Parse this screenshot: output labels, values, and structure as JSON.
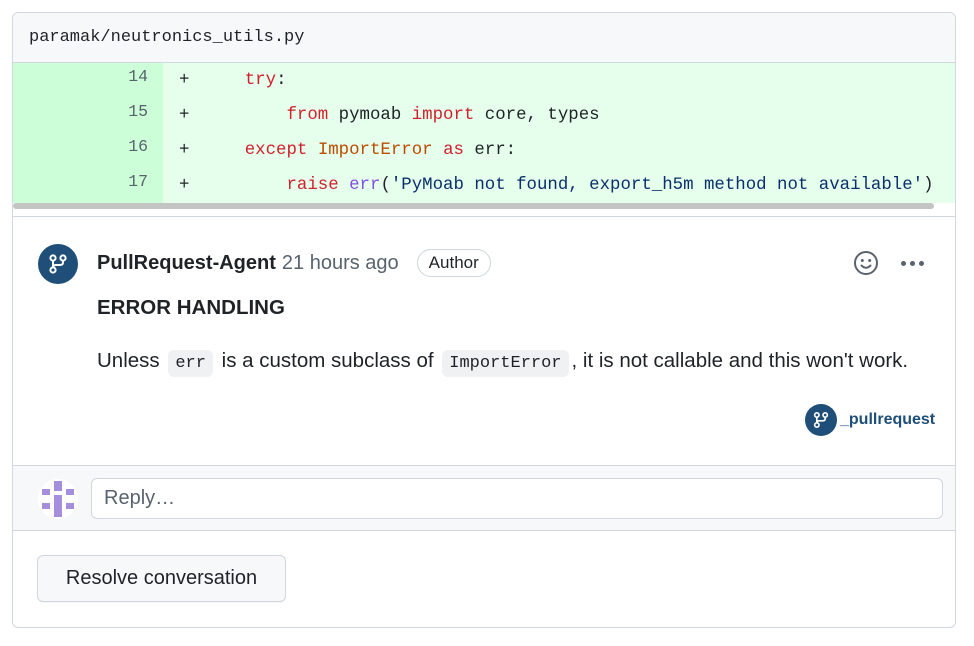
{
  "file": {
    "path": "paramak/neutronics_utils.py"
  },
  "diff": {
    "lines": [
      {
        "number": "14",
        "sign": "+"
      },
      {
        "number": "15",
        "sign": "+"
      },
      {
        "number": "16",
        "sign": "+"
      },
      {
        "number": "17",
        "sign": "+"
      }
    ],
    "tokens": {
      "try": "try",
      "colon": ":",
      "from": "from",
      "pymoab": " pymoab ",
      "import": "import",
      "core_types": " core, types",
      "except": "except",
      "importerror": "ImportError",
      "as": "as",
      "err_colon": " err:",
      "raise": "raise",
      "err_fn": "err",
      "paren_open": "(",
      "message": "'PyMoab not found, export_h5m method not available'",
      "paren_close": ")"
    }
  },
  "comment": {
    "author": "PullRequest-Agent",
    "time": "21 hours ago",
    "badge": "Author",
    "heading": "ERROR HANDLING",
    "body": {
      "part1": "Unless ",
      "code1": "err",
      "part2": " is a custom subclass of ",
      "code2": "ImportError",
      "part3": ", it is not callable and this won't work."
    },
    "signature": "_pullrequest"
  },
  "reply": {
    "placeholder": "Reply…"
  },
  "actions": {
    "resolve_label": "Resolve conversation"
  },
  "colors": {
    "added_line_bg": "#e6ffec",
    "added_number_bg": "#ccffd8",
    "brand": "#1f4e79",
    "keyword": "#cf222e",
    "exception": "#bc4c00",
    "string": "#0a3069",
    "function": "#8250df"
  },
  "icons": [
    "pull-request-icon",
    "smiley-icon",
    "kebab-menu-icon",
    "identicon"
  ]
}
